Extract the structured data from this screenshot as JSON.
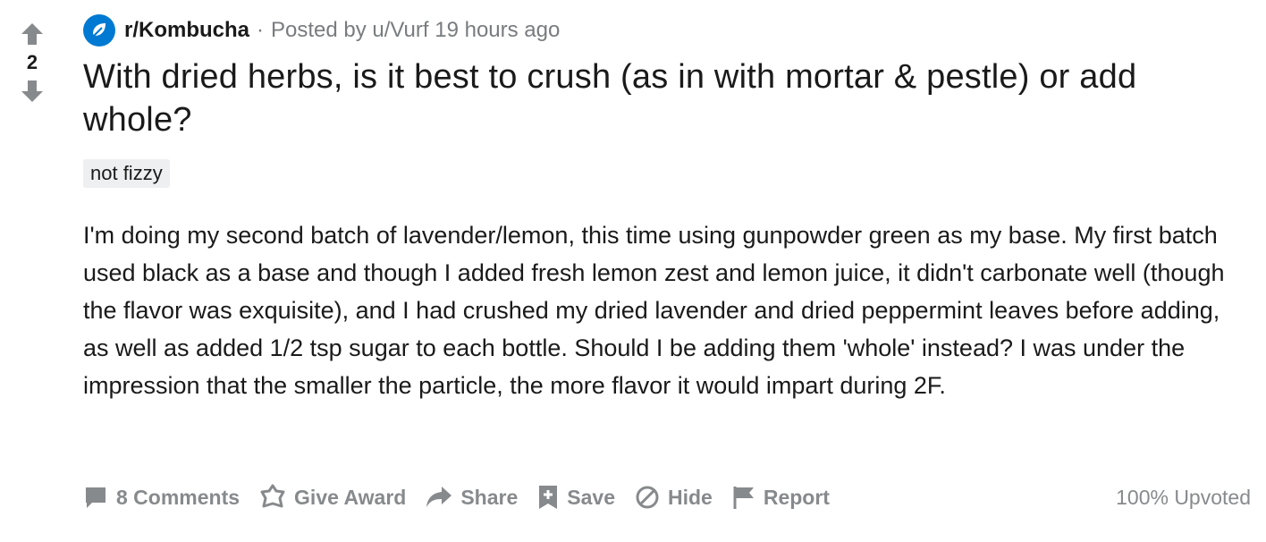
{
  "vote": {
    "count": "2"
  },
  "meta": {
    "subreddit": "r/Kombucha",
    "separator": "·",
    "posted_by": "Posted by u/Vurf 19 hours ago"
  },
  "post": {
    "title": "With dried herbs, is it best to crush (as in with mortar & pestle) or add whole?",
    "flair": "not fizzy",
    "body": "I'm doing my second batch of lavender/lemon, this time using gunpowder green as my base. My first batch used black as a base and though I added fresh lemon zest and lemon juice, it didn't carbonate well (though the flavor was exquisite), and I had crushed my dried lavender and dried peppermint leaves before adding, as well as added 1/2 tsp sugar to each bottle. Should I be adding them 'whole' instead? I was under the impression that the smaller the particle, the more flavor it would impart during 2F."
  },
  "actions": {
    "comments": "8 Comments",
    "award": "Give Award",
    "share": "Share",
    "save": "Save",
    "hide": "Hide",
    "report": "Report",
    "upvoted": "100% Upvoted"
  },
  "colors": {
    "subreddit_icon": "#0079d3",
    "action_gray": "#878a8c",
    "flair_bg": "#edeff1"
  },
  "icons": {
    "upvote": "arrow-up-icon",
    "downvote": "arrow-down-icon",
    "subreddit": "subreddit-icon",
    "comments": "comment-icon",
    "award": "award-icon",
    "share": "share-icon",
    "save": "save-icon",
    "hide": "hide-icon",
    "report": "report-icon"
  }
}
